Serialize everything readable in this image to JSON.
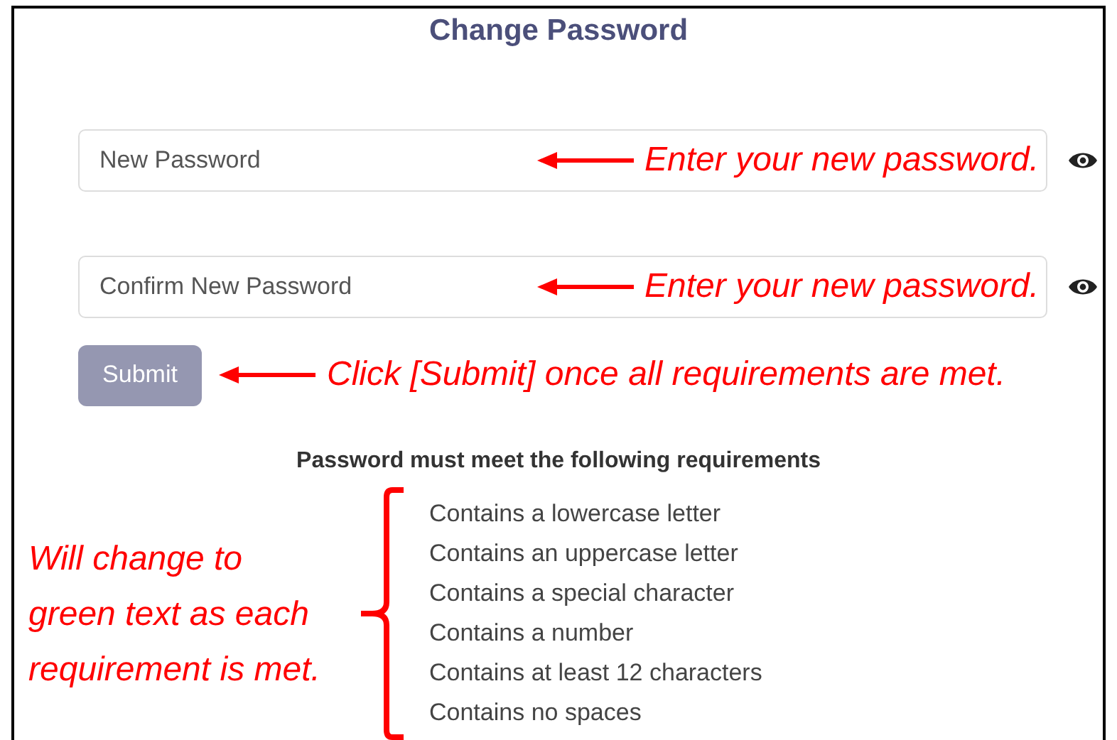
{
  "title": "Change Password",
  "fields": [
    {
      "placeholder": "New Password",
      "note": "Enter your new password."
    },
    {
      "placeholder": "Confirm New Password",
      "note": "Enter your new password."
    }
  ],
  "submit": {
    "label": "Submit",
    "disabled": true,
    "note": "Click [Submit] once all requirements are met."
  },
  "requirements": {
    "heading": "Password must meet the following requirements",
    "items": [
      {
        "text": "Contains a lowercase letter",
        "met": false
      },
      {
        "text": "Contains an uppercase letter",
        "met": false
      },
      {
        "text": "Contains a special character",
        "met": false
      },
      {
        "text": "Contains a number",
        "met": false
      },
      {
        "text": "Contains at least 12 characters",
        "met": false
      },
      {
        "text": "Contains no spaces",
        "met": false
      }
    ],
    "note_lines": [
      "Will change to",
      "green text as each",
      "requirement is met."
    ]
  }
}
